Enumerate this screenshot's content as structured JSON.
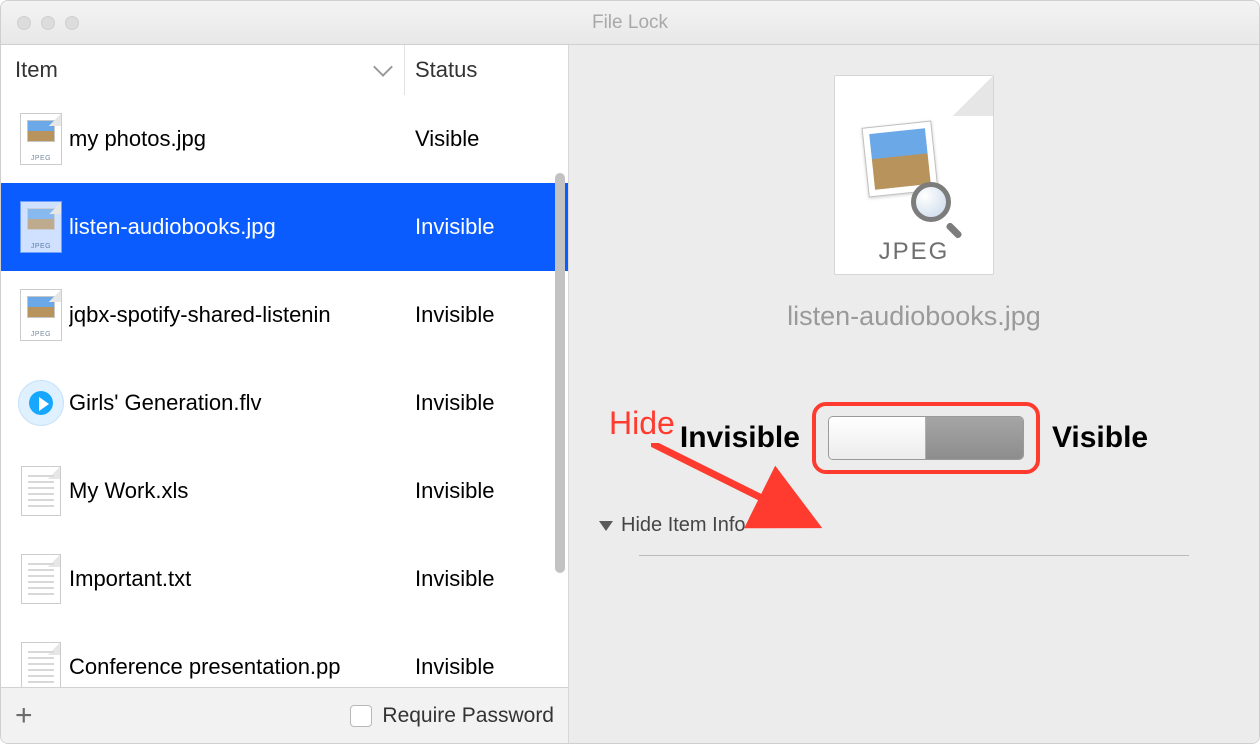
{
  "window": {
    "title": "File Lock"
  },
  "columns": {
    "item": "Item",
    "status": "Status"
  },
  "files": [
    {
      "name": "my photos.jpg",
      "status": "Visible",
      "icon": "jpeg",
      "selected": false
    },
    {
      "name": "listen-audiobooks.jpg",
      "status": "Invisible",
      "icon": "jpeg",
      "selected": true
    },
    {
      "name": "jqbx-spotify-shared-listenin",
      "status": "Invisible",
      "icon": "jpeg",
      "selected": false
    },
    {
      "name": "Girls' Generation.flv",
      "status": "Invisible",
      "icon": "flv",
      "selected": false
    },
    {
      "name": "My Work.xls",
      "status": "Invisible",
      "icon": "doc",
      "selected": false
    },
    {
      "name": "Important.txt",
      "status": "Invisible",
      "icon": "doc",
      "selected": false
    },
    {
      "name": "Conference presentation.pp",
      "status": "Invisible",
      "icon": "doc",
      "selected": false
    }
  ],
  "toolbar": {
    "add_button": "+",
    "require_password": "Require Password"
  },
  "detail": {
    "type_label": "JPEG",
    "filename": "listen-audiobooks.jpg",
    "toggle_left": "Invisible",
    "toggle_right": "Visible",
    "toggle_state": "invisible",
    "hide_item_info": "Hide Item Info"
  },
  "annotation": {
    "hide": "Hide"
  },
  "icon_labels": {
    "jpeg": "JPEG"
  }
}
